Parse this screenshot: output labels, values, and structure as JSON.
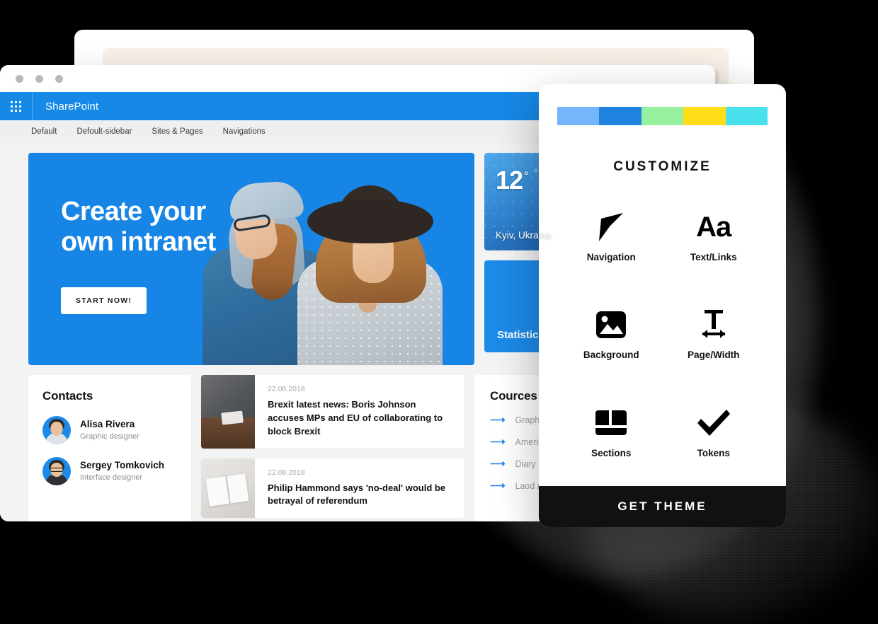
{
  "back_window": {
    "squares_count": 3
  },
  "browser": {
    "traffic_lights": 3,
    "sharepoint_title": "SharePoint",
    "waffle_icon": "waffle-grid-icon",
    "subnav": [
      {
        "label": "Default"
      },
      {
        "label": "Defoult-sidebar"
      },
      {
        "label": "Sites & Pages"
      },
      {
        "label": "Navigations"
      }
    ]
  },
  "hero": {
    "heading": "Create your\nown intranet",
    "button_label": "START NOW!",
    "background_color": "#1785e5"
  },
  "weather": {
    "temperature": "12",
    "degree_symbol": "°",
    "location": "Kyiv, Ukraine"
  },
  "statistic": {
    "label": "Statistics",
    "background_color": "#1c8ae8"
  },
  "contacts": {
    "title": "Contacts",
    "items": [
      {
        "name": "Alisa Rivera",
        "role": "Graphic designer"
      },
      {
        "name": "Sergey Tomkovich",
        "role": "Interface designer"
      }
    ]
  },
  "news": {
    "items": [
      {
        "date": "22.08.2018",
        "title": "Brexit latest news: Boris Johnson accuses MPs and EU of collaborating to block Brexit"
      },
      {
        "date": "22.08.2018",
        "title": "Philip Hammond says 'no-deal' would be betrayal of referendum"
      }
    ]
  },
  "cources": {
    "title": "Cources",
    "items": [
      {
        "label": "Graphic design"
      },
      {
        "label": "American english"
      },
      {
        "label": "Diary management"
      },
      {
        "label": "Laod management"
      }
    ]
  },
  "customize_panel": {
    "title": "CUSTOMIZE",
    "swatches": [
      {
        "name": "light-blue",
        "color": "#73b6fc"
      },
      {
        "name": "blue",
        "color": "#1e84df"
      },
      {
        "name": "green",
        "color": "#96f0a0"
      },
      {
        "name": "yellow",
        "color": "#ffde17"
      },
      {
        "name": "cyan",
        "color": "#48e0ec"
      }
    ],
    "options": [
      {
        "label": "Navigation",
        "icon": "cursor-arrow-icon"
      },
      {
        "label": "Text/Links",
        "icon": "aa-typography-icon",
        "glyph": "Aa"
      },
      {
        "label": "Background",
        "icon": "image-icon"
      },
      {
        "label": "Page/Width",
        "icon": "page-width-icon"
      },
      {
        "label": "Sections",
        "icon": "sections-layout-icon"
      },
      {
        "label": "Tokens",
        "icon": "checkmark-icon"
      }
    ],
    "cta_label": "GET THEME"
  }
}
